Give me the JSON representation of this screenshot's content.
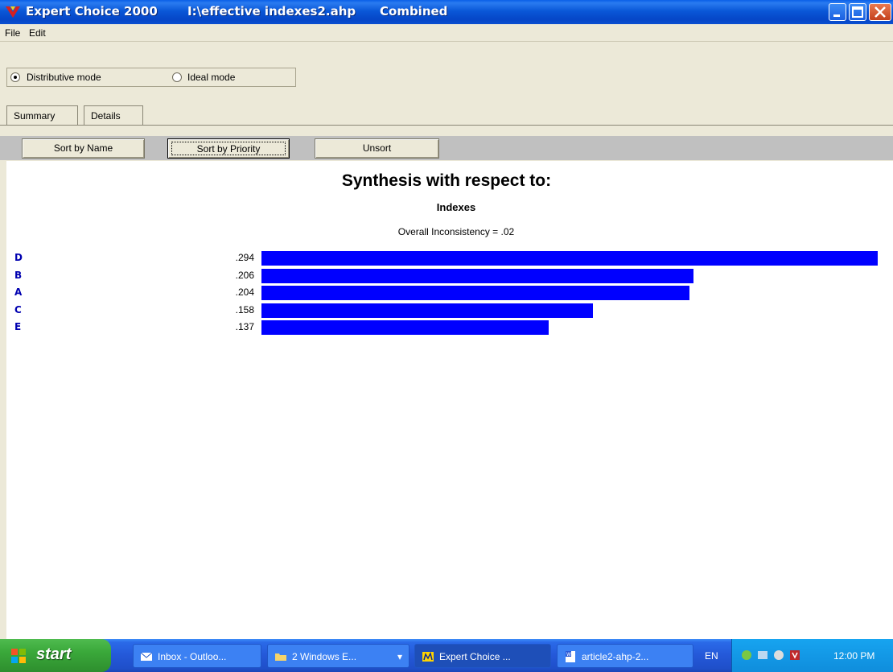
{
  "window": {
    "app_title": "Expert Choice 2000",
    "file_path": "I:\\effective indexes2.ahp",
    "view_name": "Combined"
  },
  "menu": {
    "items": [
      "File",
      "Edit"
    ]
  },
  "modes": {
    "distributive": "Distributive mode",
    "ideal": "Ideal mode",
    "selected": "distributive"
  },
  "tabs": [
    "Summary",
    "Details"
  ],
  "sort_buttons": {
    "by_name": "Sort by Name",
    "by_priority": "Sort by Priority",
    "unsort": "Unsort"
  },
  "synthesis": {
    "title": "Synthesis with respect to:",
    "goal": "Indexes",
    "inconsistency": "Overall Inconsistency = .02"
  },
  "chart_data": {
    "type": "bar",
    "orientation": "horizontal",
    "categories": [
      "D",
      "B",
      "A",
      "C",
      "E"
    ],
    "values": [
      0.294,
      0.206,
      0.204,
      0.158,
      0.137
    ],
    "value_labels": [
      ".294",
      ".206",
      ".204",
      ".158",
      ".137"
    ],
    "bar_color": "#0000ff",
    "grid": false
  },
  "taskbar": {
    "start": "start",
    "tasks": [
      "Inbox - Outloo...",
      "2 Windows E...",
      "Expert Choice ...",
      "article2-ahp-2..."
    ],
    "language": "EN",
    "clock": "12:00 PM"
  }
}
